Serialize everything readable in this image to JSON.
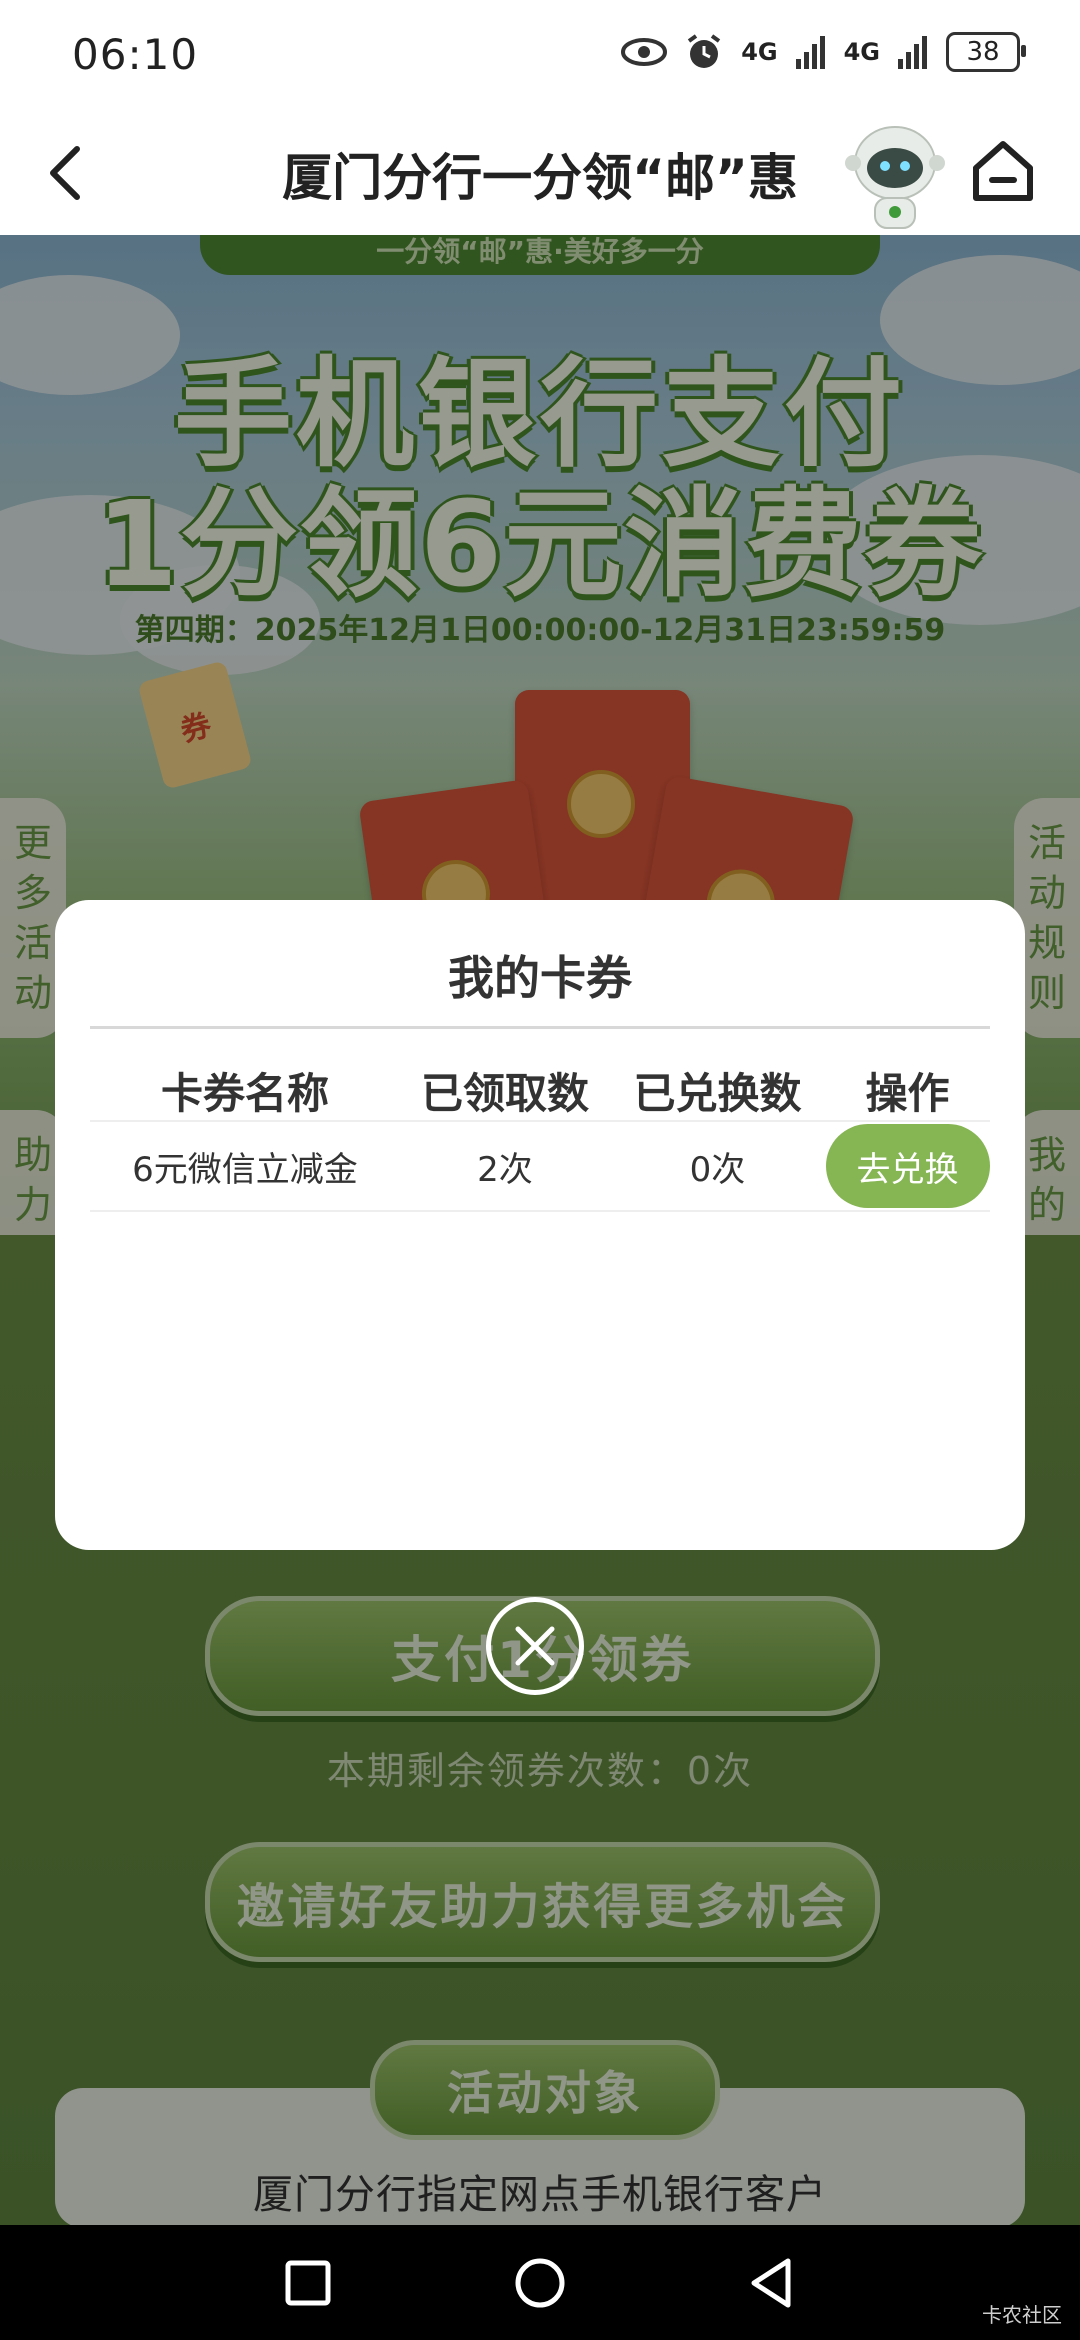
{
  "status_bar": {
    "time": "06:10",
    "network1": "4G",
    "network2": "4G",
    "battery": "38"
  },
  "header": {
    "title": "厦门分行一分领“邮”惠"
  },
  "hero": {
    "top_banner": "一分领“邮”惠·美好多一分",
    "promo_line1": "手机银行支付",
    "promo_line2": "1分领6元消费券",
    "period": "第四期：2025年12月1日00:00:00-12月31日23:59:59",
    "ticket_label": "券"
  },
  "side_tabs": {
    "more_activities": "更多活动",
    "activity_rules": "活动规则",
    "help_records": "助力记录",
    "my_coupons": "我的卡券"
  },
  "modal": {
    "title": "我的卡券",
    "columns": [
      "卡券名称",
      "已领取数",
      "已兑换数",
      "操作"
    ],
    "rows": [
      {
        "name": "6元微信立减金",
        "claimed": "2次",
        "redeemed": "0次",
        "action": "去兑换"
      }
    ]
  },
  "lower": {
    "pay_button": "支付1分领券",
    "remaining": "本期剩余领券次数：0次",
    "invite_button": "邀请好友助力获得更多机会",
    "target_tag": "活动对象",
    "target_text": "厦门分行指定网点手机银行客户"
  },
  "watermark": "卡农社区",
  "colors": {
    "accent_green": "#86b553",
    "dark_green": "#4d8a2f"
  }
}
